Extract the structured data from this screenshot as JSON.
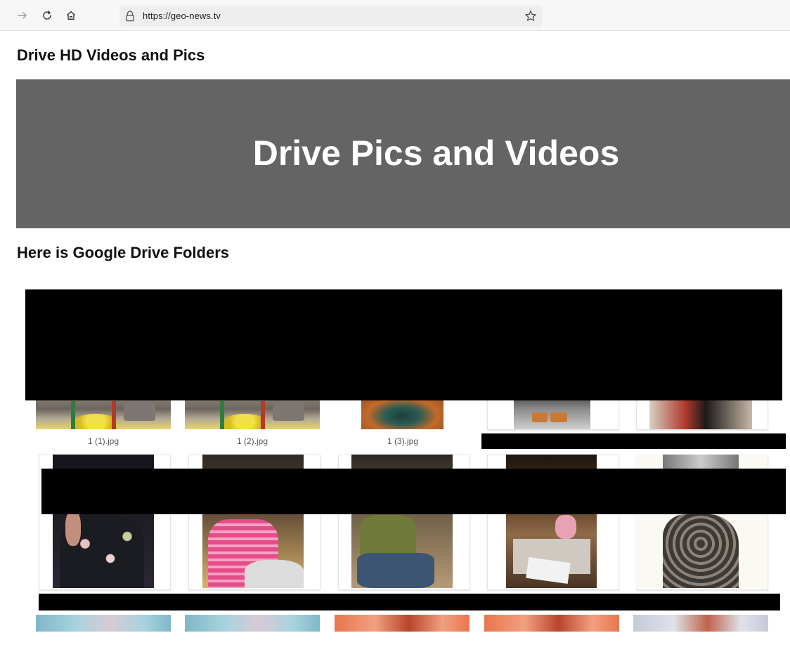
{
  "browser": {
    "url": "https://geo-news.tv"
  },
  "page": {
    "heading": "Drive HD Videos and Pics",
    "hero_title": "Drive Pics and Videos",
    "folders_heading": "Here is Google Drive Folders"
  },
  "files": [
    {
      "name": "1 (1).jpg"
    },
    {
      "name": "1 (2).jpg"
    },
    {
      "name": "1 (3).jpg"
    }
  ],
  "colors": {
    "hero_bg": "#646464",
    "redaction": "#000000"
  }
}
